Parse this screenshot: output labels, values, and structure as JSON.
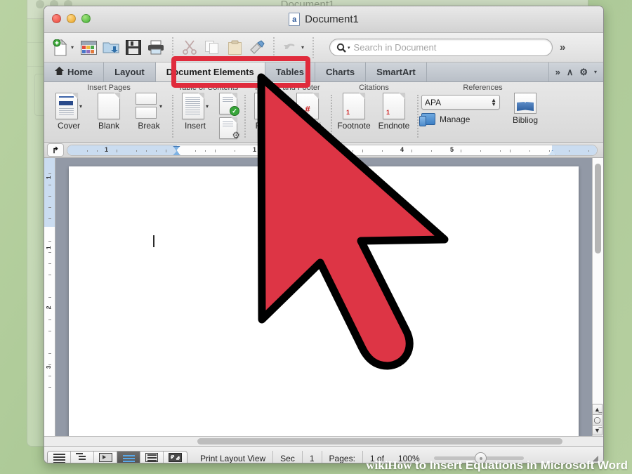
{
  "window": {
    "title": "Document1",
    "doc_icon_letter": "a",
    "traffic_lights": [
      "close",
      "minimize",
      "maximize"
    ]
  },
  "ghost_window": {
    "title": "Document1"
  },
  "standard_toolbar": {
    "buttons": [
      {
        "name": "new-document",
        "glyph": "➕"
      },
      {
        "name": "elements-gallery",
        "glyph": "▦"
      },
      {
        "name": "open-document",
        "glyph": "⤵"
      },
      {
        "name": "save-document",
        "glyph": "ὋE"
      },
      {
        "name": "print-document",
        "glyph": "⎙"
      },
      {
        "name": "cut",
        "glyph": "✂"
      },
      {
        "name": "copy",
        "glyph": "⧉"
      },
      {
        "name": "paste",
        "glyph": "ὌB"
      },
      {
        "name": "format-painter",
        "glyph": "὘C"
      },
      {
        "name": "undo",
        "glyph": "↶"
      }
    ],
    "overflow_label": "»"
  },
  "search": {
    "placeholder": "Search in Document",
    "value": "",
    "icon": "search-icon"
  },
  "ribbon": {
    "tabs": [
      {
        "label": "Home",
        "icon": "home-icon",
        "active": false
      },
      {
        "label": "Layout",
        "icon": "",
        "active": false
      },
      {
        "label": "Document Elements",
        "icon": "",
        "active": true
      },
      {
        "label": "Tables",
        "icon": "",
        "active": false
      },
      {
        "label": "Charts",
        "icon": "",
        "active": false
      },
      {
        "label": "SmartArt",
        "icon": "",
        "active": false
      }
    ],
    "right_controls": {
      "overflow": "»",
      "collapse": "∧",
      "gear": "⚙",
      "gear_caret": "▾"
    },
    "highlight": {
      "target_tab": "Document Elements",
      "color": "#e02b3c"
    },
    "groups": [
      {
        "title": "Insert Pages",
        "items": [
          {
            "label": "Cover",
            "icon": "cover-page-icon",
            "has_caret": true
          },
          {
            "label": "Blank",
            "icon": "blank-page-icon",
            "has_caret": false
          },
          {
            "label": "Break",
            "icon": "page-break-icon",
            "has_caret": true
          }
        ]
      },
      {
        "title": "Table of Contents",
        "items": [
          {
            "label": "Insert",
            "icon": "toc-insert-icon",
            "has_caret": true
          },
          {
            "label": "",
            "icon": "toc-update-icon",
            "has_caret": false
          },
          {
            "label": "",
            "icon": "toc-options-icon",
            "has_caret": false
          }
        ]
      },
      {
        "title": "Header and Footer",
        "items": [
          {
            "label": "Footer",
            "icon": "footer-icon",
            "has_caret": true
          },
          {
            "label": "Page #",
            "icon": "page-number-icon",
            "has_caret": false
          }
        ]
      },
      {
        "title": "Citations",
        "items": [
          {
            "label": "Footnote",
            "icon": "footnote-icon",
            "has_caret": false
          },
          {
            "label": "Endnote",
            "icon": "endnote-icon",
            "has_caret": false
          }
        ]
      },
      {
        "title": "References",
        "style_select": {
          "value": "APA",
          "name": "citation-style-select"
        },
        "manage_label": "Manage",
        "items": [
          {
            "label": "Bibliog",
            "icon": "bibliography-icon",
            "has_caret": false
          }
        ]
      }
    ]
  },
  "ruler": {
    "tab_selector_glyph": "↱",
    "horizontal_numbers": [
      "1",
      "1",
      "4",
      "5"
    ],
    "vertical_numbers": [
      "1",
      "1",
      "2",
      "3"
    ]
  },
  "document": {
    "caret_visible": true,
    "body_text": ""
  },
  "status_bar": {
    "view_buttons": [
      {
        "name": "draft-view",
        "active": false
      },
      {
        "name": "outline-view",
        "active": false
      },
      {
        "name": "publishing-layout-view",
        "active": false
      },
      {
        "name": "print-layout-view",
        "active": true
      },
      {
        "name": "notebook-layout-view",
        "active": false
      },
      {
        "name": "full-screen-view",
        "active": false
      }
    ],
    "view_name": "Print Layout View",
    "section_label": "Sec",
    "section_value": "1",
    "pages_label": "Pages:",
    "pages_value": "1 of",
    "zoom_value": "100%"
  },
  "cursor": {
    "name": "mouse-pointer",
    "fill": "#dd3545",
    "stroke": "#000000"
  },
  "watermark": {
    "brand": "wikiHow",
    "text": " to Insert Equations in Microsoft Word"
  }
}
